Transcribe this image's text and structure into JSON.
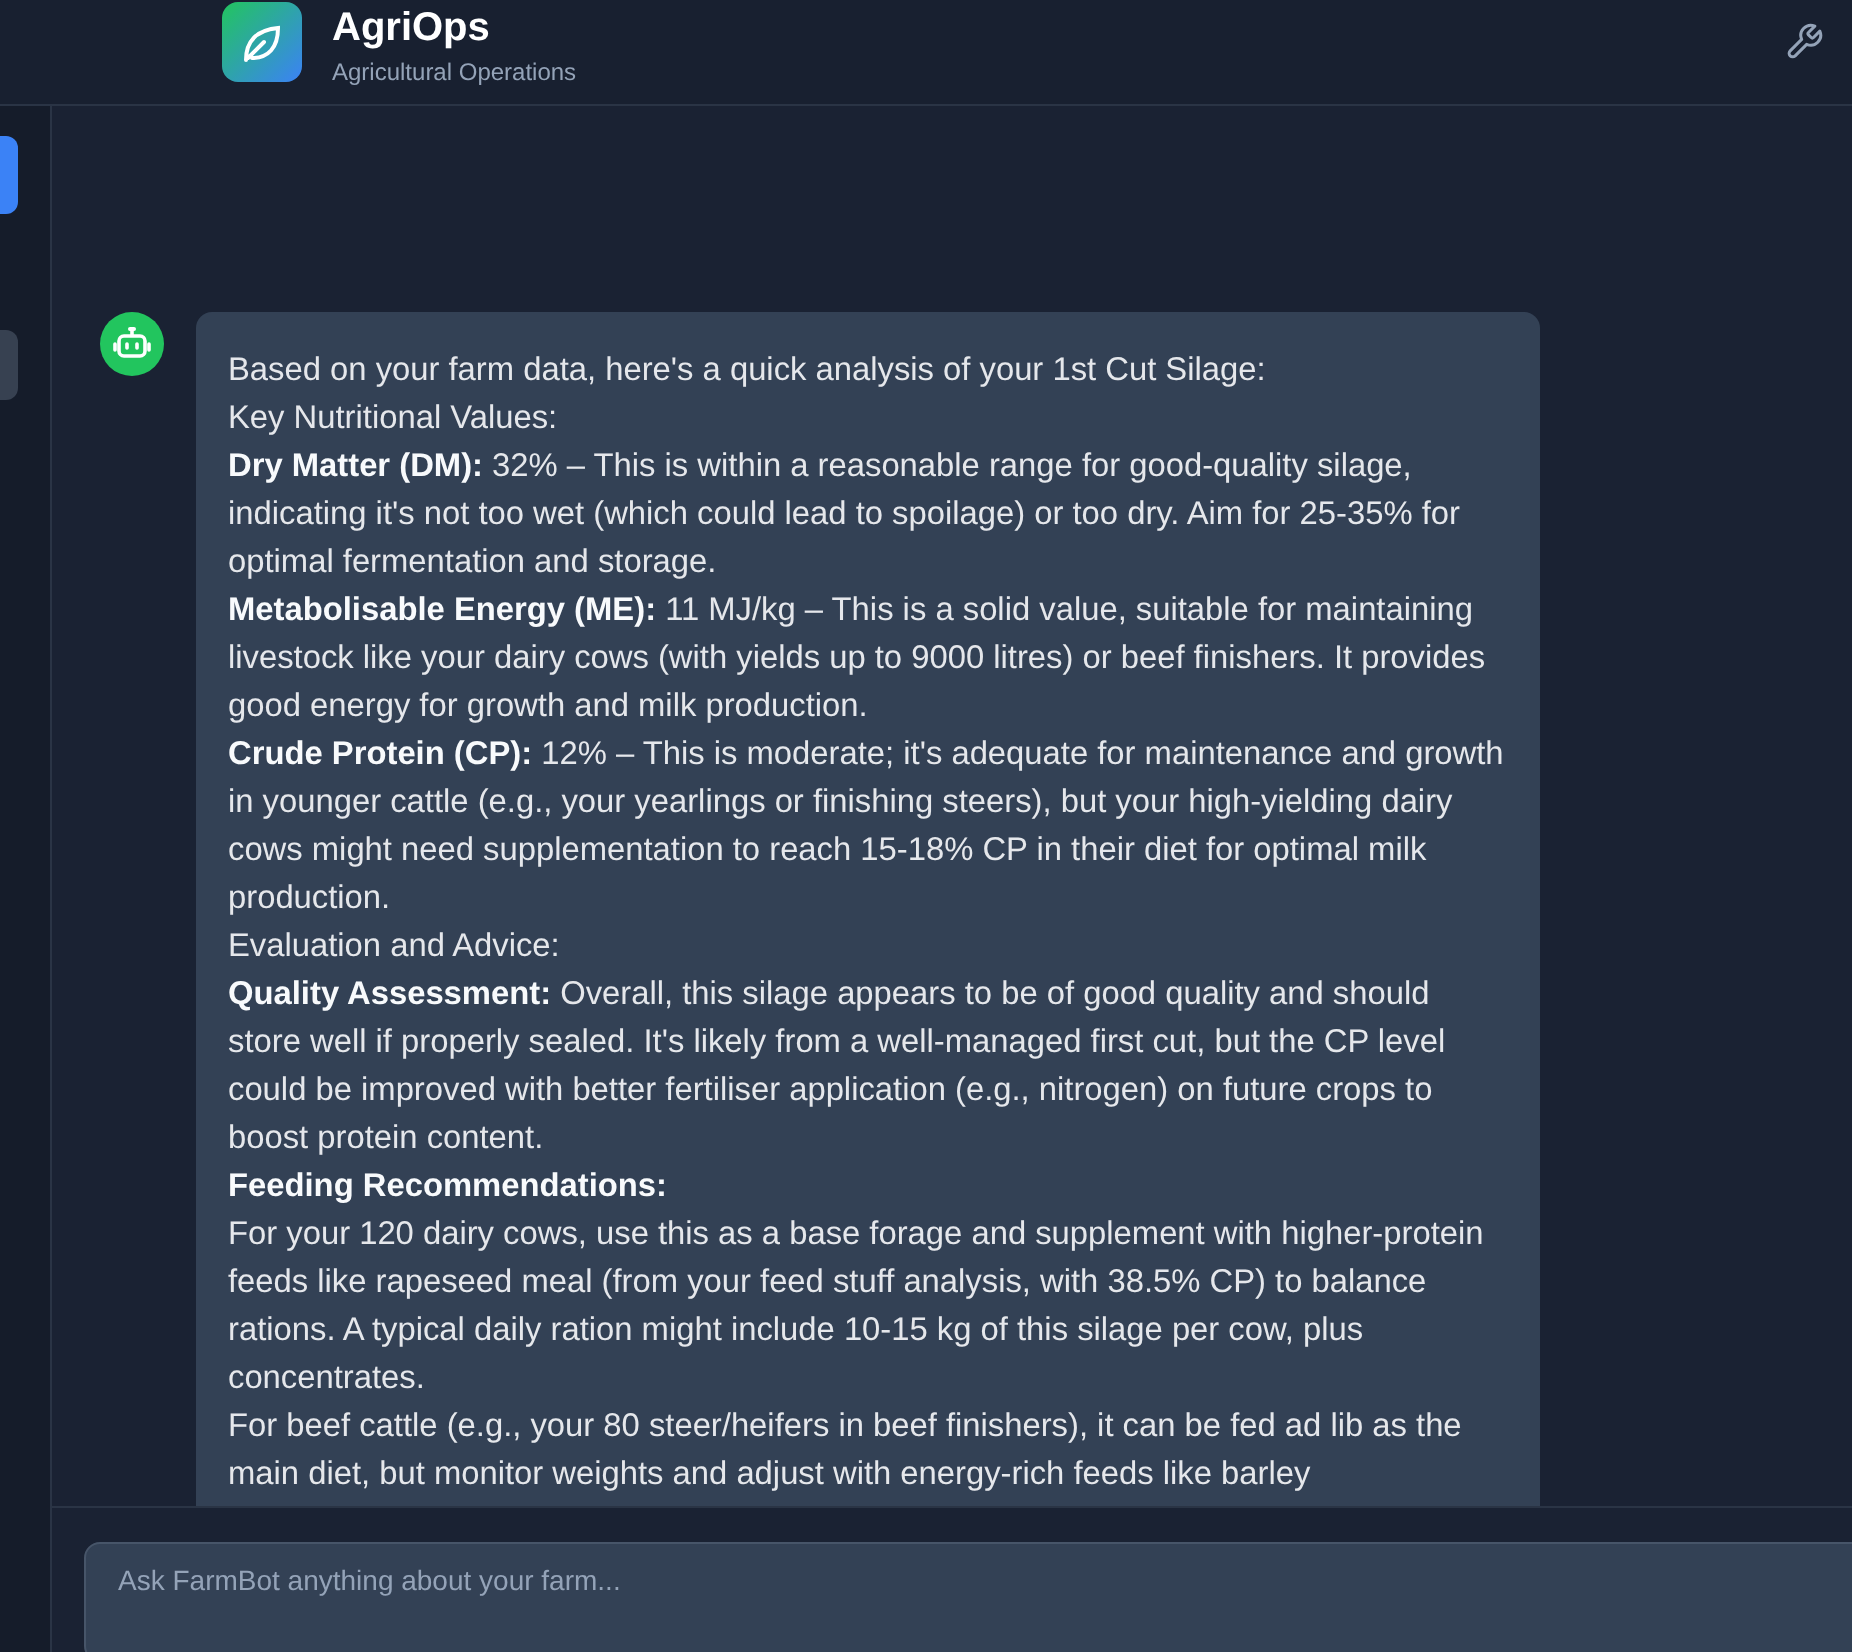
{
  "header": {
    "title": "AgriOps",
    "subtitle": "Agricultural Operations"
  },
  "messages": [
    {
      "kind": "bot",
      "paragraphs": [
        "Based on your farm data, here's a quick analysis of your 1st Cut Silage:",
        "Key Nutritional Values:",
        "**Dry Matter (DM):** 32% – This is within a reasonable range for good-quality silage, indicating it's not too wet (which could lead to spoilage) or too dry. Aim for 25-35% for optimal fermentation and storage.",
        "**Metabolisable Energy (ME):** 11 MJ/kg – This is a solid value, suitable for maintaining livestock like your dairy cows (with yields up to 9000 litres) or beef finishers. It provides good energy for growth and milk production.",
        "**Crude Protein (CP):** 12% – This is moderate; it's adequate for maintenance and growth in younger cattle (e.g., your yearlings or finishing steers), but your high-yielding dairy cows might need supplementation to reach 15-18% CP in their diet for optimal milk production.",
        "Evaluation and Advice:",
        "**Quality Assessment:** Overall, this silage appears to be of good quality and should store well if properly sealed. It's likely from a well-managed first cut, but the CP level could be improved with better fertiliser application (e.g., nitrogen) on future crops to boost protein content.",
        "**Feeding Recommendations:**",
        "For your 120 dairy cows, use this as a base forage and supplement with higher-protein feeds like rapeseed meal (from your feed stuff analysis, with 38.5% CP) to balance rations. A typical daily ration might include 10-15 kg of this silage per cow, plus concentrates.",
        "For beef cattle (e.g., your 80 steer/heifers in beef finishers), it can be fed ad lib as the main diet, but monitor weights and adjust with energy-rich feeds like barley"
      ]
    }
  ],
  "composer": {
    "placeholder": "Ask FarmBot anything about your farm..."
  }
}
